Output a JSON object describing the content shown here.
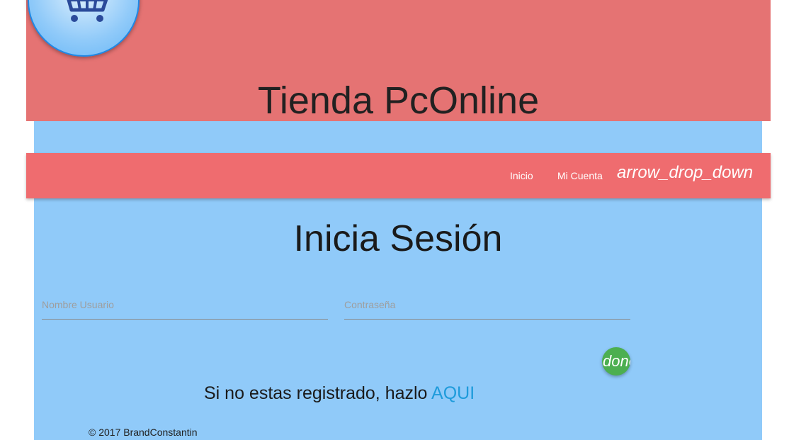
{
  "header": {
    "title": "Tienda PcOnline",
    "logo_icon": "shopping-cart-icon",
    "background": "#e57373"
  },
  "navbar": {
    "background": "#ef6c6f",
    "items": [
      {
        "label": "Inicio"
      },
      {
        "label": "Mi Cuenta"
      }
    ],
    "dropdown_icon_text": "arrow_drop_down"
  },
  "login": {
    "title": "Inicia Sesión",
    "username_placeholder": "Nombre Usuario",
    "username_value": "",
    "password_placeholder": "Contraseña",
    "password_value": "",
    "submit_icon_text": "done",
    "submit_color": "#4caf50"
  },
  "register": {
    "text": "Si no estas registrado, hazlo ",
    "link_label": "AQUI",
    "link_color": "#1e9bdb"
  },
  "footer": {
    "text": "© 2017 BrandConstantin"
  },
  "colors": {
    "content_background": "#90caf9"
  }
}
